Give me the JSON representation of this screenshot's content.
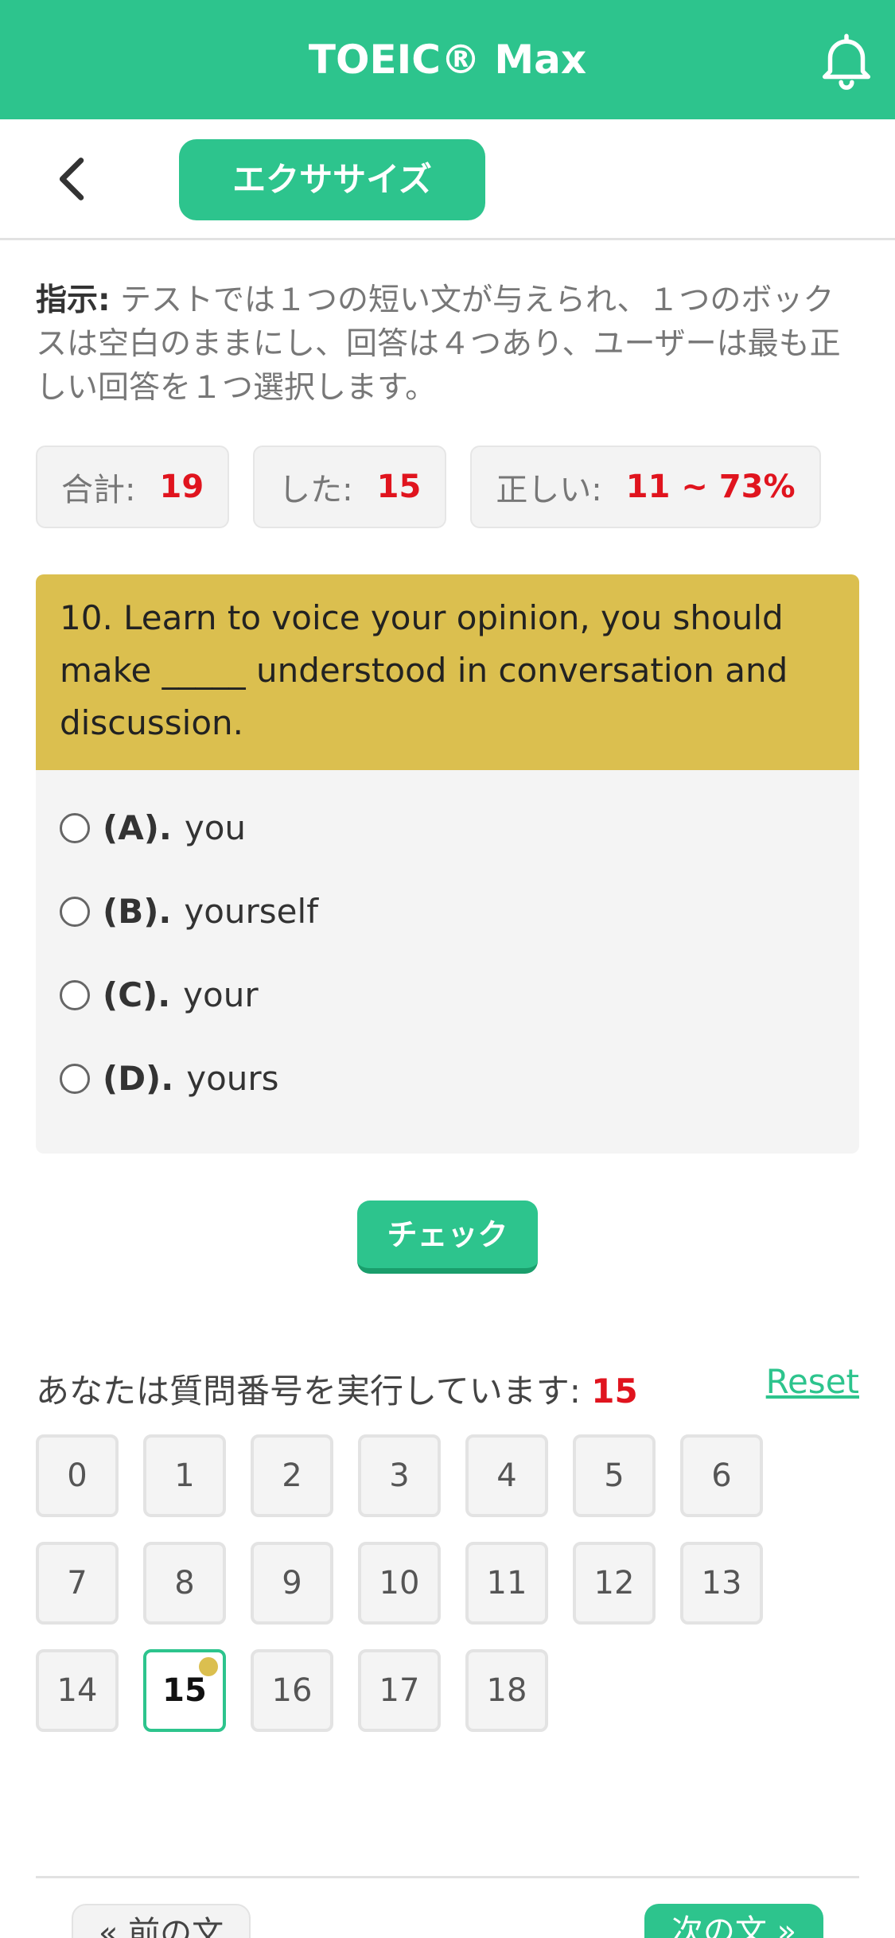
{
  "app": {
    "title": "TOEIC® Max"
  },
  "subheader": {
    "tab_label": "エクササイズ"
  },
  "instructions": {
    "label": "指示:",
    "text": " テストでは１つの短い文が与えられ、１つのボックスは空白のままにし、回答は４つあり、ユーザーは最も正しい回答を１つ選択します。"
  },
  "stats": {
    "total_label": "合計:",
    "total_value": "19",
    "done_label": "した:",
    "done_value": "15",
    "correct_label": "正しい:",
    "correct_value": "11 ~ 73%"
  },
  "question": {
    "text": "10. Learn to voice your opinion, you should make _____ understood in conversation and discussion.",
    "options": [
      {
        "letter": "(A).",
        "text": "you"
      },
      {
        "letter": "(B).",
        "text": "yourself"
      },
      {
        "letter": "(C).",
        "text": "your"
      },
      {
        "letter": "(D).",
        "text": "yours"
      }
    ]
  },
  "check_label": "チェック",
  "progress": {
    "label": "あなたは質問番号を実行しています: ",
    "current": "15",
    "reset_label": "Reset",
    "numbers": [
      "0",
      "1",
      "2",
      "3",
      "4",
      "5",
      "6",
      "7",
      "8",
      "9",
      "10",
      "11",
      "12",
      "13",
      "14",
      "15",
      "16",
      "17",
      "18"
    ],
    "active_index": 15
  },
  "footer": {
    "prev_label": "« 前の文",
    "next_label": "次の文 »"
  },
  "colors": {
    "brand": "#2dc48d",
    "question_header": "#dbbf4f",
    "accent_red": "#e0141e"
  },
  "icons": {
    "notification": "bell-icon",
    "back": "chevron-left-icon"
  }
}
